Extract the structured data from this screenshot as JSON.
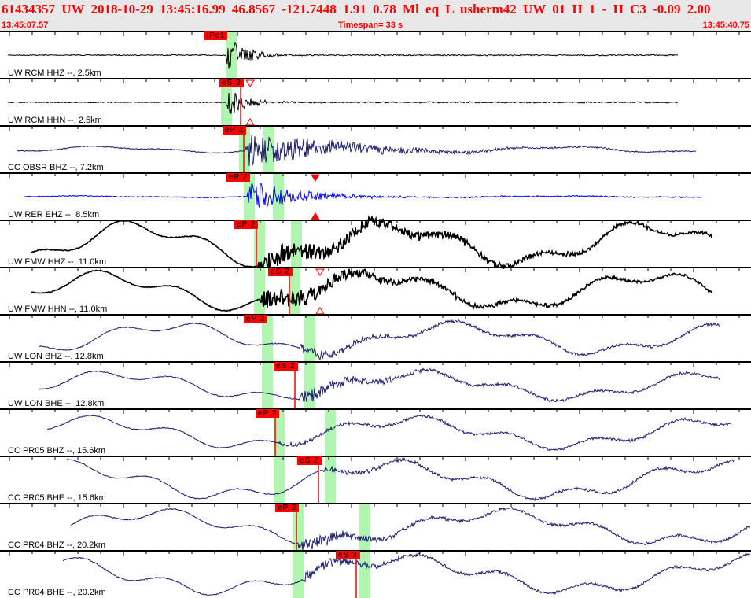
{
  "header": {
    "title": "61434357 UW 2018-10-29 13:45:16.99    46.8567 -121.7448    1.91   0.78 Ml   eq   L  usherm42  UW 01   H    1   -   H C3    -0.09   2.00",
    "start_time": "13:45:07.57",
    "timespan": "Timespan=  33 s",
    "end_time": "13:45:40.75"
  },
  "colors": {
    "pick": "#ff0000",
    "window": "#b0f5b0",
    "black": "#000000",
    "navy": "#1a1a6e",
    "blue": "#0000ff"
  },
  "channels": [
    {
      "label": "UW RCM HHZ --, 2.5km",
      "pick": "iPc1",
      "color": "black"
    },
    {
      "label": "UW RCM HHN --, 2.5km",
      "pick": "eS 3",
      "color": "black"
    },
    {
      "label": "CC OBSR BHZ --, 7.2km",
      "pick": "eP 2",
      "color": "navy"
    },
    {
      "label": "UW RER EHZ --, 8.5km",
      "pick": "eP 2",
      "color": "blue"
    },
    {
      "label": "UW FMW HHZ --, 11.0km",
      "pick": "eP 2",
      "color": "black"
    },
    {
      "label": "UW FMW HHN --, 11.0km",
      "pick": "eS 2",
      "color": "black"
    },
    {
      "label": "UW LON BHZ --, 12.8km",
      "pick": "eP 2",
      "color": "navy"
    },
    {
      "label": "UW LON BHE --, 12.8km",
      "pick": "eS 2",
      "color": "navy"
    },
    {
      "label": "CC PR05 BHZ --, 15.6km",
      "pick": "eP 2",
      "color": "navy"
    },
    {
      "label": "CC PR05 BHE --, 15.6km",
      "pick": "eS 2",
      "color": "navy"
    },
    {
      "label": "CC PR04 BHZ --, 20.2km",
      "pick": "eP 2",
      "color": "navy"
    },
    {
      "label": "CC PR04 BHE --, 20.2km",
      "pick": "eS 3",
      "color": "navy"
    }
  ]
}
